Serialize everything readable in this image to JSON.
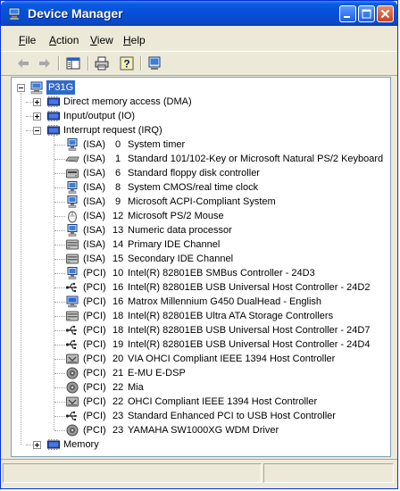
{
  "window": {
    "title": "Device Manager"
  },
  "menu": [
    "File",
    "Action",
    "View",
    "Help"
  ],
  "menu_underline": [
    "F",
    "A",
    "V",
    "H"
  ],
  "toolbar_icons": [
    "back-arrow-icon",
    "forward-arrow-icon",
    "show-hide-console-tree-icon",
    "print-icon",
    "help-icon",
    "properties-icon"
  ],
  "tree": {
    "root": "P31G",
    "groups": [
      {
        "label": "Direct memory access (DMA)",
        "expanded": false
      },
      {
        "label": "Input/output (IO)",
        "expanded": false
      },
      {
        "label": "Interrupt request (IRQ)",
        "expanded": true
      }
    ],
    "irq_items": [
      {
        "bus": "(ISA)",
        "irq": "0",
        "name": "System timer",
        "icon": "system-device-icon"
      },
      {
        "bus": "(ISA)",
        "irq": "1",
        "name": "Standard 101/102-Key or Microsoft Natural PS/2 Keyboard",
        "icon": "keyboard-icon"
      },
      {
        "bus": "(ISA)",
        "irq": "6",
        "name": "Standard floppy disk controller",
        "icon": "disk-controller-icon"
      },
      {
        "bus": "(ISA)",
        "irq": "8",
        "name": "System CMOS/real time clock",
        "icon": "system-device-icon"
      },
      {
        "bus": "(ISA)",
        "irq": "9",
        "name": "Microsoft ACPI-Compliant System",
        "icon": "system-device-icon"
      },
      {
        "bus": "(ISA)",
        "irq": "12",
        "name": "Microsoft PS/2 Mouse",
        "icon": "mouse-icon"
      },
      {
        "bus": "(ISA)",
        "irq": "13",
        "name": "Numeric data processor",
        "icon": "system-device-icon"
      },
      {
        "bus": "(ISA)",
        "irq": "14",
        "name": "Primary IDE Channel",
        "icon": "ide-channel-icon"
      },
      {
        "bus": "(ISA)",
        "irq": "15",
        "name": "Secondary IDE Channel",
        "icon": "ide-channel-icon"
      },
      {
        "bus": "(PCI)",
        "irq": "10",
        "name": "Intel(R) 82801EB SMBus Controller - 24D3",
        "icon": "system-device-icon"
      },
      {
        "bus": "(PCI)",
        "irq": "16",
        "name": "Intel(R) 82801EB USB Universal Host Controller - 24D2",
        "icon": "usb-icon"
      },
      {
        "bus": "(PCI)",
        "irq": "16",
        "name": "Matrox Millennium G450 DualHead - English",
        "icon": "display-adapter-icon"
      },
      {
        "bus": "(PCI)",
        "irq": "18",
        "name": "Intel(R) 82801EB Ultra ATA Storage Controllers",
        "icon": "ide-channel-icon"
      },
      {
        "bus": "(PCI)",
        "irq": "18",
        "name": "Intel(R) 82801EB USB Universal Host Controller - 24D7",
        "icon": "usb-icon"
      },
      {
        "bus": "(PCI)",
        "irq": "19",
        "name": "Intel(R) 82801EB USB Universal Host Controller - 24D4",
        "icon": "usb-icon"
      },
      {
        "bus": "(PCI)",
        "irq": "20",
        "name": "VIA OHCI Compliant IEEE 1394 Host Controller",
        "icon": "ieee1394-icon"
      },
      {
        "bus": "(PCI)",
        "irq": "21",
        "name": "E-MU E-DSP",
        "icon": "sound-device-icon"
      },
      {
        "bus": "(PCI)",
        "irq": "22",
        "name": "Mia",
        "icon": "sound-device-icon"
      },
      {
        "bus": "(PCI)",
        "irq": "22",
        "name": "OHCI Compliant IEEE 1394 Host Controller",
        "icon": "ieee1394-icon"
      },
      {
        "bus": "(PCI)",
        "irq": "23",
        "name": "Standard Enhanced PCI to USB Host Controller",
        "icon": "usb-icon"
      },
      {
        "bus": "(PCI)",
        "irq": "23",
        "name": "YAMAHA SW1000XG WDM Driver",
        "icon": "sound-device-icon"
      }
    ],
    "tail_group": {
      "label": "Memory",
      "expanded": false
    }
  },
  "colors": {
    "title_bar": "#0a5ae0",
    "selection": "#316ac5",
    "window_face": "#ece9d8"
  }
}
